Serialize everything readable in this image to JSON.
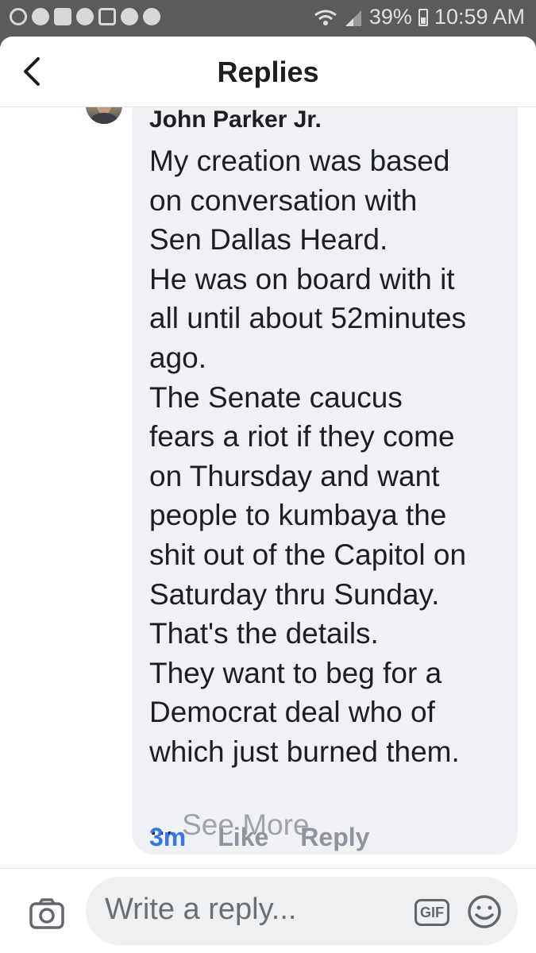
{
  "status_bar": {
    "battery": "39%",
    "time": "10:59 AM",
    "icons": [
      "notification-icon",
      "messenger-icon",
      "home-icon",
      "alert-icon",
      "image-icon",
      "heart-icon",
      "messenger-icon",
      "wifi-icon",
      "signal-icon",
      "battery-icon"
    ]
  },
  "header": {
    "title": "Replies",
    "back_icon": "chevron-left-icon"
  },
  "comment": {
    "author": "John Parker Jr.",
    "lines": [
      "My creation was based",
      "on conversation with",
      "Sen Dallas Heard.",
      "He was on board with it",
      "all until about 52minutes",
      "ago.",
      "The Senate caucus",
      "fears a riot if they come",
      "on Thursday and want",
      "people to kumbaya the",
      "shit out of the Capitol on",
      "Saturday thru Sunday.",
      "That's the details.",
      "They want to beg for a",
      "Democrat deal who of",
      "which just burned them."
    ],
    "ellipsis": "...",
    "see_more": "See More",
    "time": "3m",
    "like": "Like",
    "reply": "Reply"
  },
  "composer": {
    "placeholder": "Write a reply...",
    "gif_label": "GIF",
    "camera_icon": "camera-icon",
    "emoji_icon": "smiley-icon"
  }
}
